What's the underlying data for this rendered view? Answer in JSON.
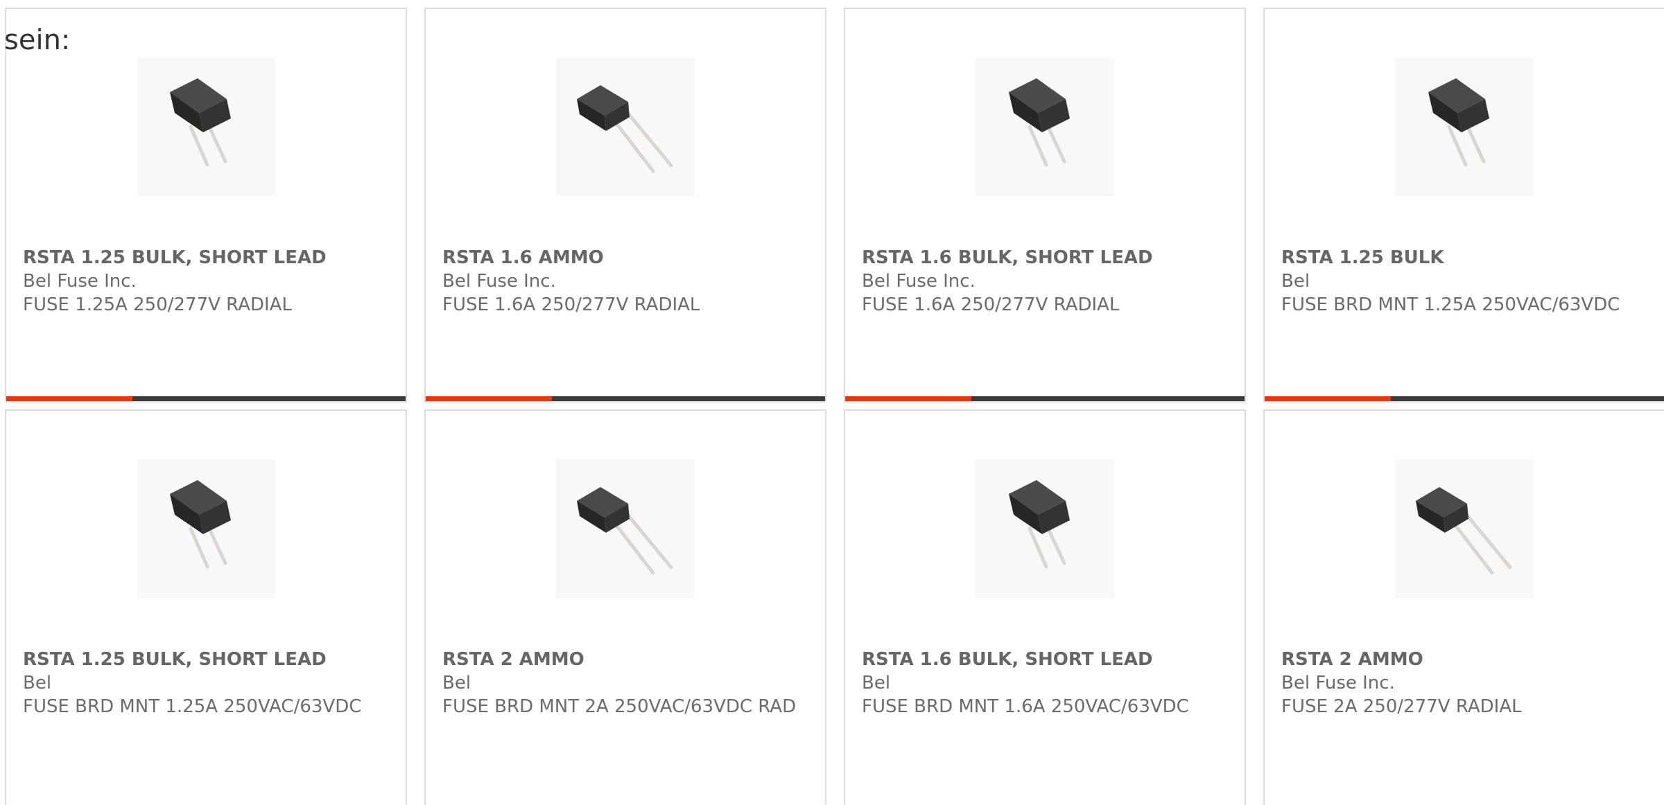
{
  "intro_text": "sein:",
  "colors": {
    "accent": "#e03a12",
    "bar_dark": "#3a3a3a",
    "card_border": "#dcdcdc",
    "text_muted": "#6b6b6b"
  },
  "products": [
    {
      "part_number": "RSTA 1.25 BULK, SHORT LEAD",
      "manufacturer": "Bel Fuse Inc.",
      "description": "FUSE 1.25A 250/277V RADIAL",
      "image": "fuse-short-lead-icon"
    },
    {
      "part_number": "RSTA 1.6 AMMO",
      "manufacturer": "Bel Fuse Inc.",
      "description": "FUSE 1.6A 250/277V RADIAL",
      "image": "fuse-long-lead-icon"
    },
    {
      "part_number": "RSTA 1.6 BULK, SHORT LEAD",
      "manufacturer": "Bel Fuse Inc.",
      "description": "FUSE 1.6A 250/277V RADIAL",
      "image": "fuse-short-lead-icon"
    },
    {
      "part_number": "RSTA 1.25 BULK",
      "manufacturer": "Bel",
      "description": "FUSE BRD MNT 1.25A 250VAC/63VDC",
      "image": "fuse-short-lead-icon"
    },
    {
      "part_number": "RSTA 1.25 BULK, SHORT LEAD",
      "manufacturer": "Bel",
      "description": "FUSE BRD MNT 1.25A 250VAC/63VDC",
      "image": "fuse-short-lead-icon"
    },
    {
      "part_number": "RSTA 2 AMMO",
      "manufacturer": "Bel",
      "description": "FUSE BRD MNT 2A 250VAC/63VDC RAD",
      "image": "fuse-long-lead-icon"
    },
    {
      "part_number": "RSTA 1.6 BULK, SHORT LEAD",
      "manufacturer": "Bel",
      "description": "FUSE BRD MNT 1.6A 250VAC/63VDC",
      "image": "fuse-short-lead-icon"
    },
    {
      "part_number": "RSTA 2 AMMO",
      "manufacturer": "Bel Fuse Inc.",
      "description": "FUSE 2A 250/277V RADIAL",
      "image": "fuse-long-lead-icon"
    }
  ]
}
